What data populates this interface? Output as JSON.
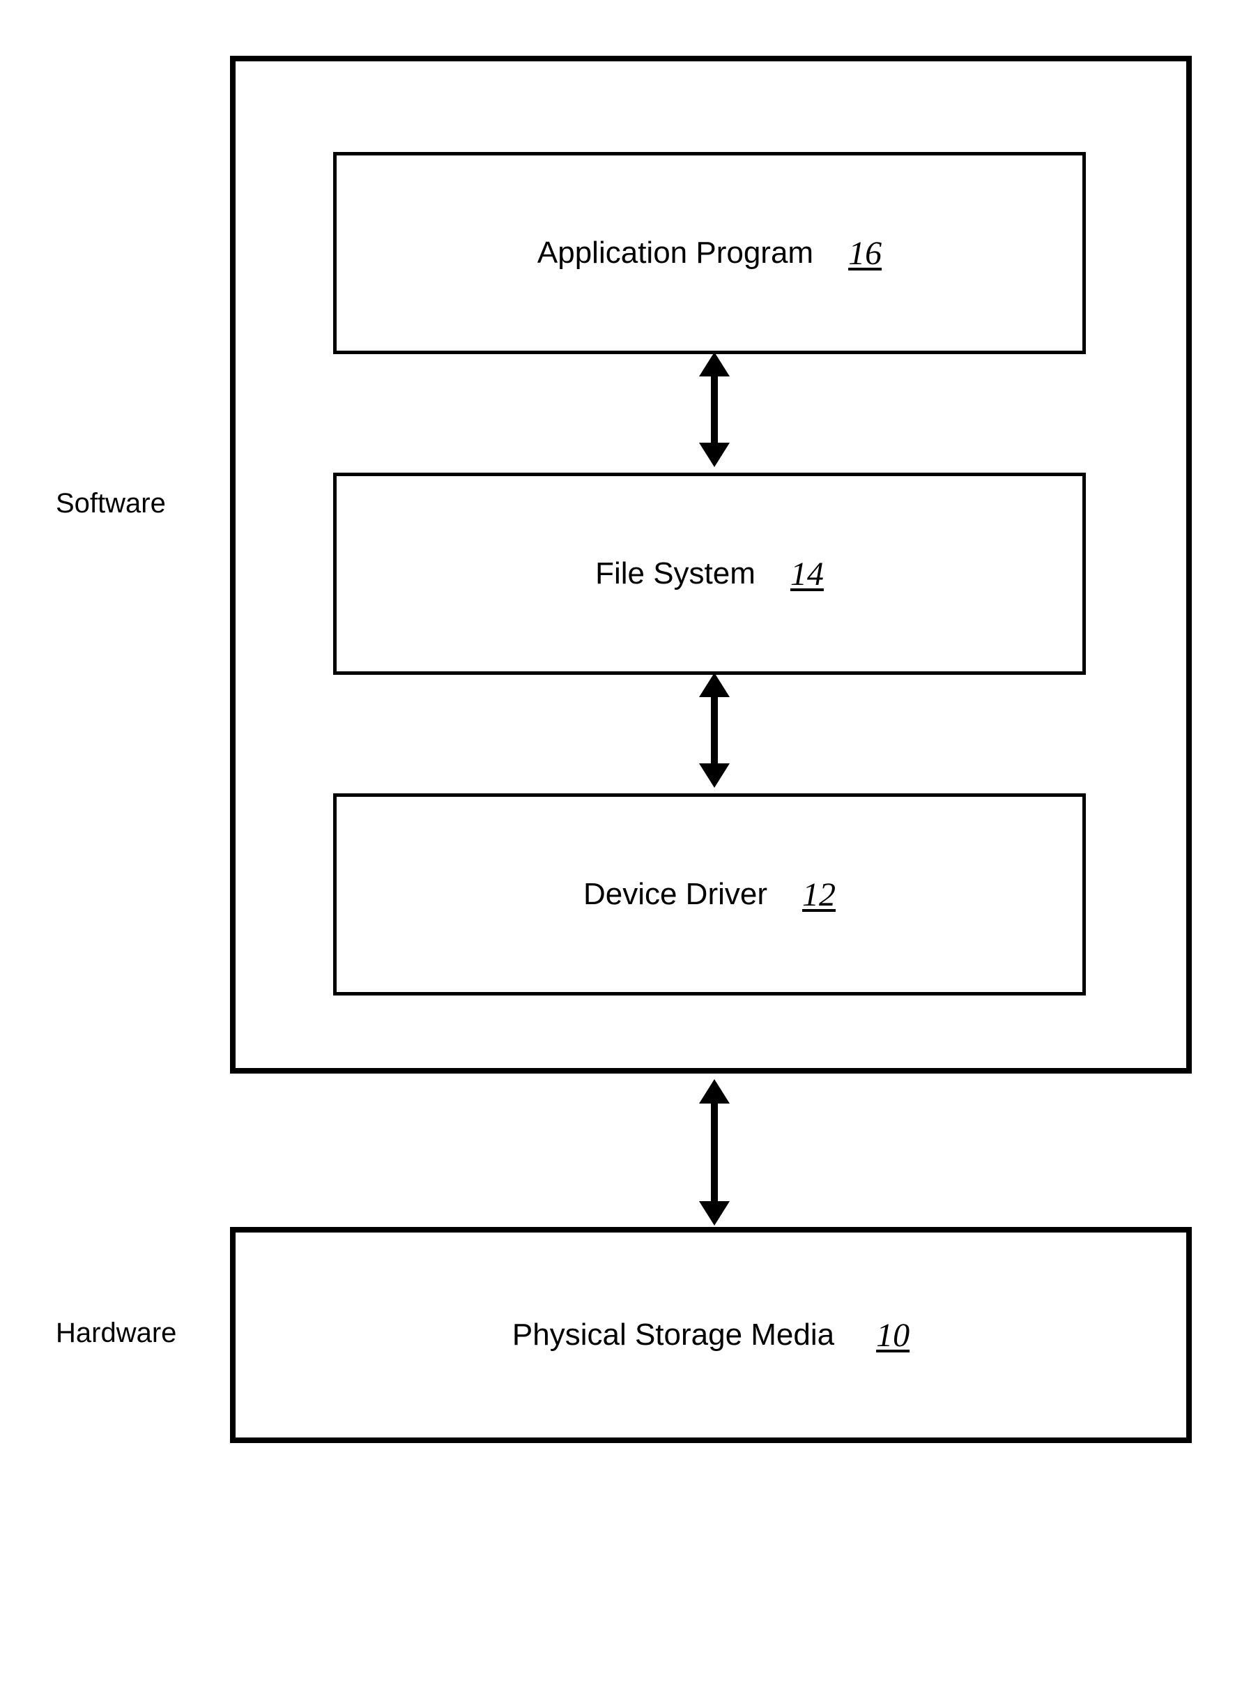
{
  "labels": {
    "software": "Software",
    "hardware": "Hardware"
  },
  "boxes": {
    "application_program": {
      "label": "Application Program",
      "ref": "16"
    },
    "file_system": {
      "label": "File System",
      "ref": "14"
    },
    "device_driver": {
      "label": "Device Driver",
      "ref": "12"
    },
    "physical_storage": {
      "label": "Physical Storage Media",
      "ref": "10"
    }
  }
}
